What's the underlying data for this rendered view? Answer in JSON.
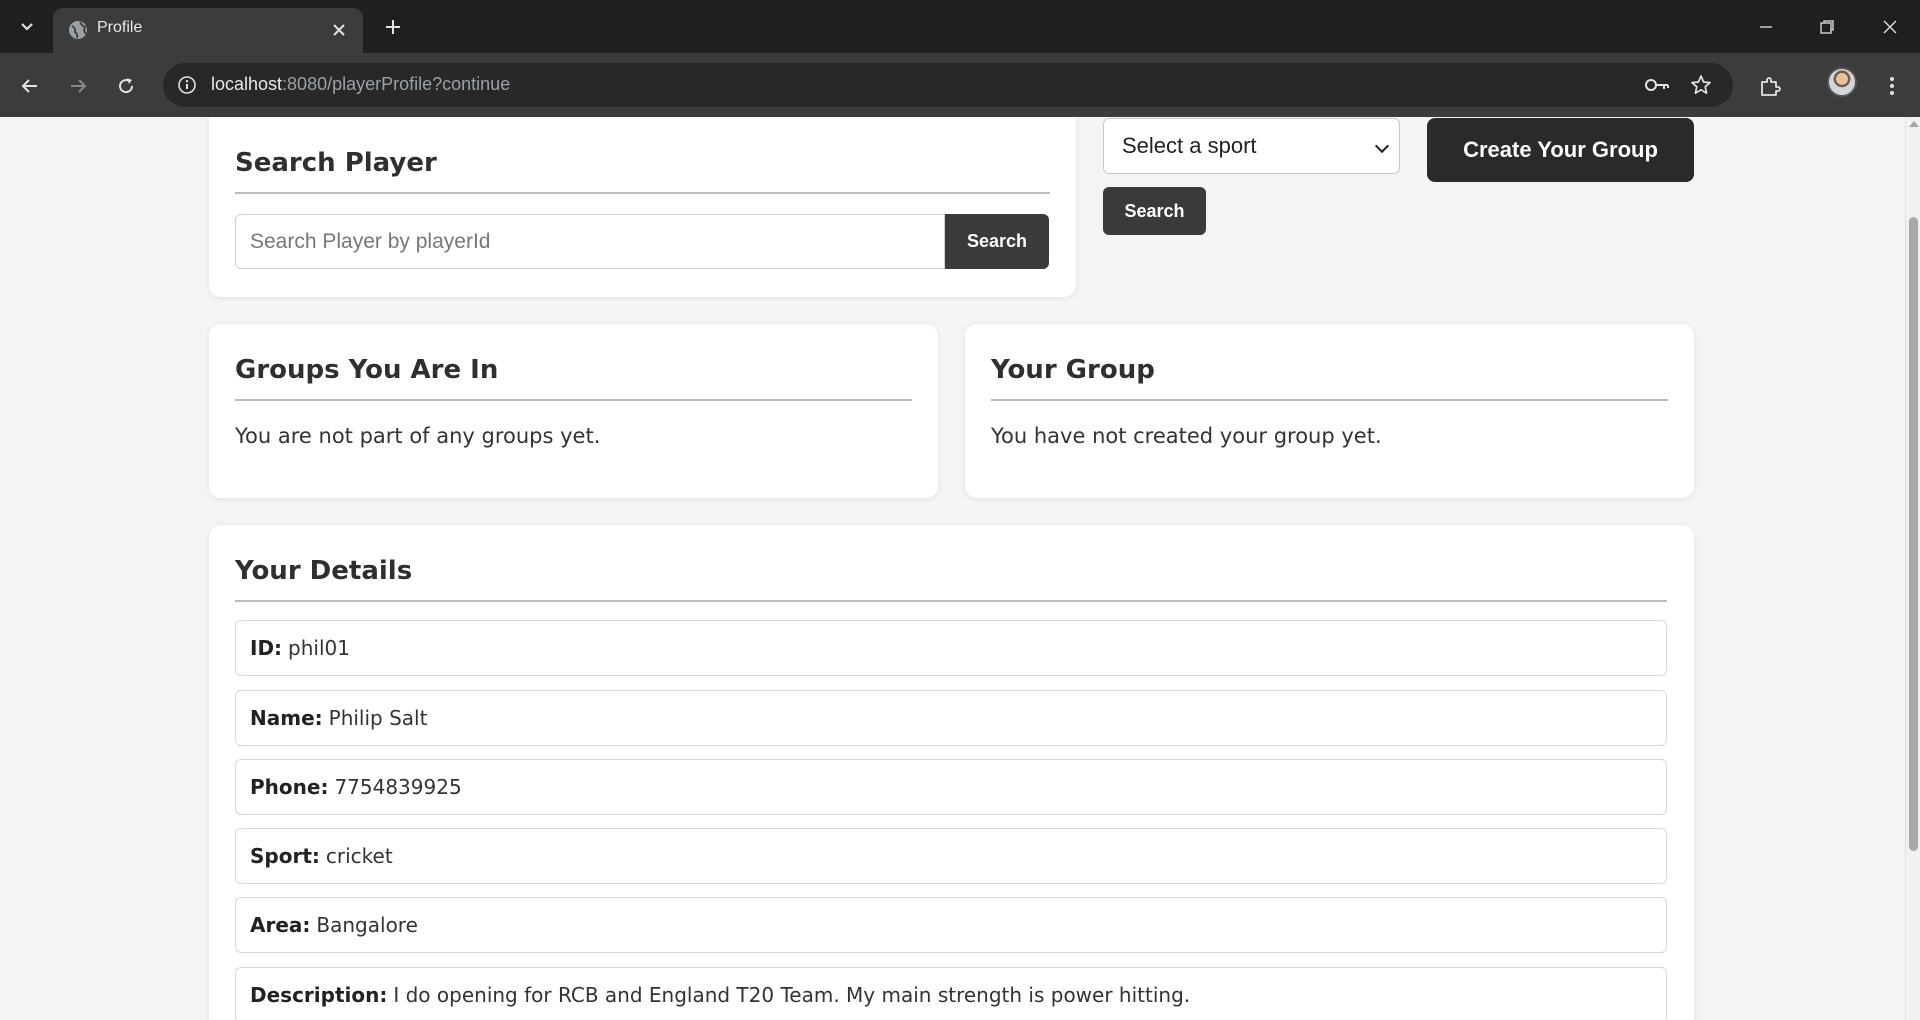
{
  "browser": {
    "tab_title": "Profile",
    "url_host": "localhost",
    "url_rest": ":8080/playerProfile?continue"
  },
  "search_player": {
    "title": "Search Player",
    "placeholder": "Search Player by playerId",
    "button": "Search"
  },
  "sport_filter": {
    "selected": "Select a sport",
    "button": "Search"
  },
  "create_group": {
    "label": "Create Your Group"
  },
  "groups_in": {
    "title": "Groups You Are In",
    "empty_text": "You are not part of any groups yet."
  },
  "your_group": {
    "title": "Your Group",
    "empty_text": "You have not created your group yet."
  },
  "details": {
    "title": "Your Details",
    "rows": [
      {
        "label": "ID:",
        "value": "phil01"
      },
      {
        "label": "Name:",
        "value": "Philip Salt"
      },
      {
        "label": "Phone:",
        "value": "7754839925"
      },
      {
        "label": "Sport:",
        "value": "cricket"
      },
      {
        "label": "Area:",
        "value": "Bangalore"
      },
      {
        "label": "Description:",
        "value": "I do opening for RCB and England T20 Team. My main strength is power hitting."
      }
    ]
  }
}
